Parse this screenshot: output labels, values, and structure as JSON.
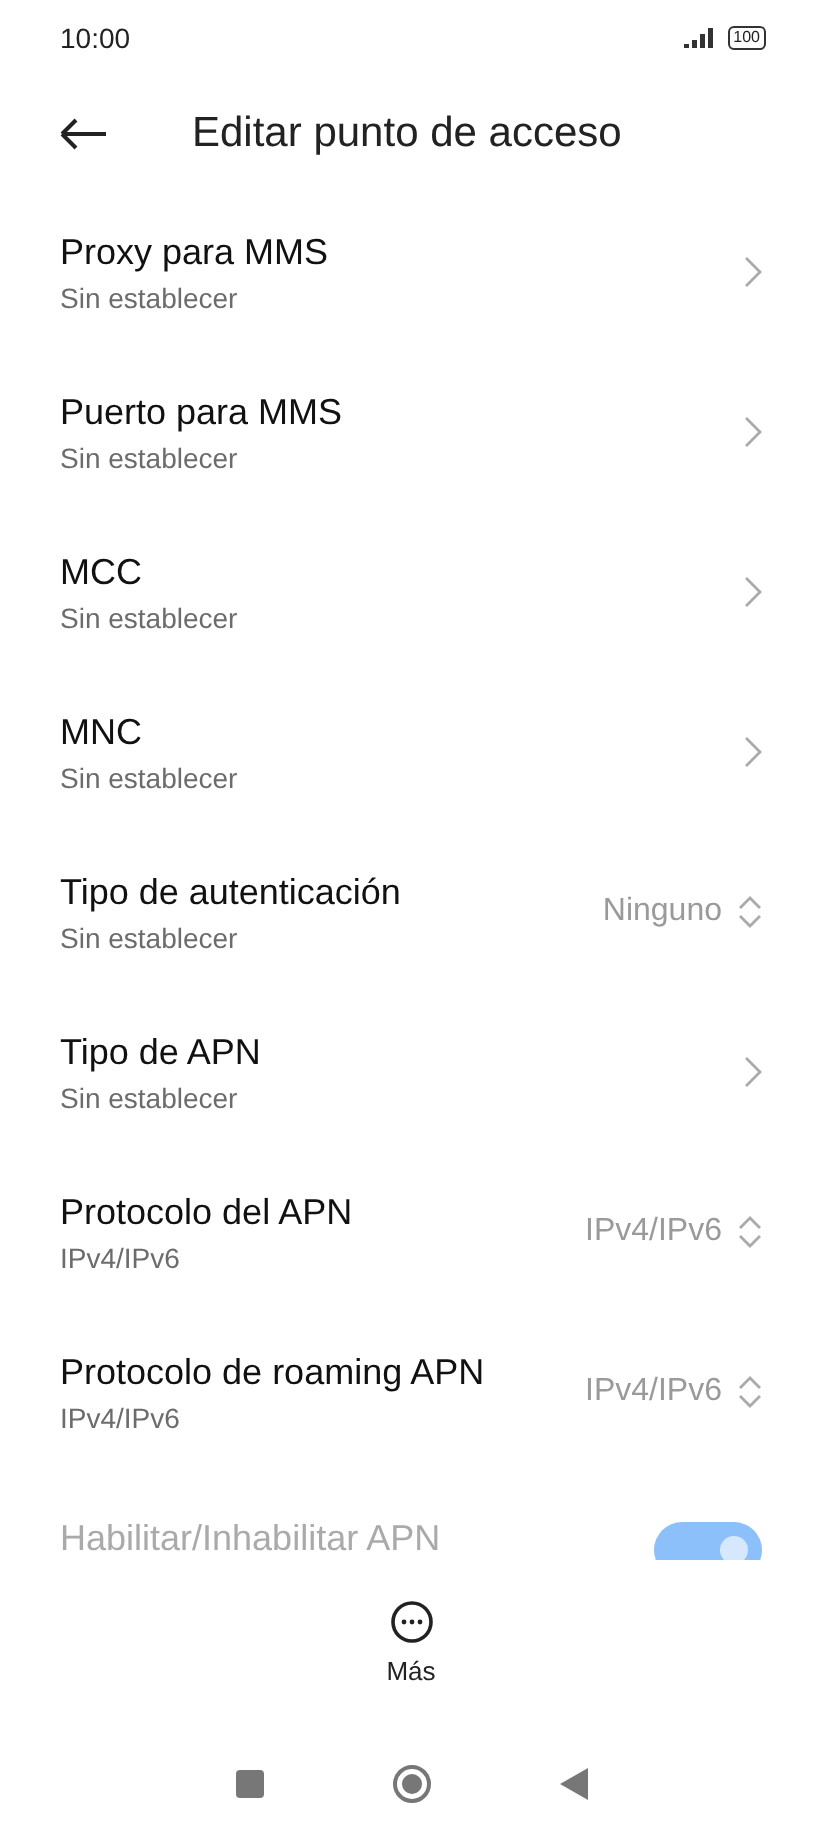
{
  "status_bar": {
    "time": "10:00",
    "battery": "100"
  },
  "header": {
    "title": "Editar punto de acceso"
  },
  "settings": [
    {
      "kind": "link",
      "title": "Proxy para MMS",
      "subtitle": "Sin establecer"
    },
    {
      "kind": "link",
      "title": "Puerto para MMS",
      "subtitle": "Sin establecer"
    },
    {
      "kind": "link",
      "title": "MCC",
      "subtitle": "Sin establecer"
    },
    {
      "kind": "link",
      "title": "MNC",
      "subtitle": "Sin establecer"
    },
    {
      "kind": "select",
      "title": "Tipo de autenticación",
      "subtitle": "Sin establecer",
      "value": "Ninguno"
    },
    {
      "kind": "link",
      "title": "Tipo de APN",
      "subtitle": "Sin establecer"
    },
    {
      "kind": "select",
      "title": "Protocolo del APN",
      "subtitle": "IPv4/IPv6",
      "value": "IPv4/IPv6"
    },
    {
      "kind": "select",
      "title": "Protocolo de roaming APN",
      "subtitle": "IPv4/IPv6",
      "value": "IPv4/IPv6"
    },
    {
      "kind": "toggle",
      "title": "Habilitar/Inhabilitar APN",
      "on": true
    }
  ],
  "more_button": {
    "label": "Más"
  }
}
